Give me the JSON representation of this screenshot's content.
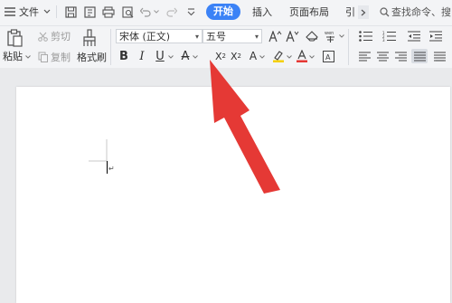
{
  "topbar": {
    "file_menu": "文件",
    "tabs": [
      {
        "label": "开始",
        "active": true
      },
      {
        "label": "插入",
        "active": false
      },
      {
        "label": "页面布局",
        "active": false
      },
      {
        "label": "引",
        "active": false
      }
    ],
    "search_label": "查找命令、搜"
  },
  "ribbon": {
    "paste_label": "粘贴",
    "cut_label": "剪切",
    "copy_label": "复制",
    "format_painter_label": "格式刷",
    "font_name": "宋体 (正文)",
    "font_size": "五号"
  },
  "colors": {
    "accent": "#3b82f6",
    "arrow": "#e53935",
    "highlight": "#f5d000",
    "font_color": "#e53935"
  }
}
